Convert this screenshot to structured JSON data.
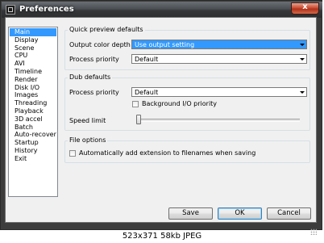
{
  "window": {
    "title": "Preferences",
    "close_label": "x"
  },
  "sidebar": {
    "items": [
      {
        "label": "Main",
        "selected": true
      },
      {
        "label": "Display"
      },
      {
        "label": "Scene"
      },
      {
        "label": "CPU"
      },
      {
        "label": "AVI"
      },
      {
        "label": "Timeline"
      },
      {
        "label": "Render"
      },
      {
        "label": "Disk I/O"
      },
      {
        "label": "Images"
      },
      {
        "label": "Threading"
      },
      {
        "label": "Playback"
      },
      {
        "label": "3D accel"
      },
      {
        "label": "Batch"
      },
      {
        "label": "Auto-recover"
      },
      {
        "label": "Startup"
      },
      {
        "label": "History"
      },
      {
        "label": "Exit"
      }
    ]
  },
  "quick_preview": {
    "title": "Quick preview defaults",
    "output_color_depth_label": "Output color depth",
    "output_color_depth_value": "Use output setting",
    "process_priority_label": "Process priority",
    "process_priority_value": "Default"
  },
  "dub": {
    "title": "Dub defaults",
    "process_priority_label": "Process priority",
    "process_priority_value": "Default",
    "background_io_label": "Background I/O priority",
    "background_io_checked": false,
    "speed_limit_label": "Speed limit",
    "speed_limit_level": 0
  },
  "file_options": {
    "title": "File options",
    "auto_ext_label": "Automatically add extension to filenames when saving",
    "auto_ext_checked": false
  },
  "buttons": {
    "save": "Save",
    "ok": "OK",
    "cancel": "Cancel"
  },
  "caption": "523x371 58kb JPEG"
}
